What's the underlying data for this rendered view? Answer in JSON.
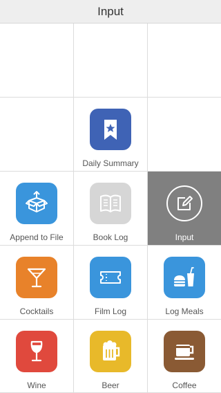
{
  "header": {
    "title": "Input"
  },
  "actions": [
    {
      "label": "Daily Summary",
      "icon": "bookmark-star-icon",
      "color": "#3f63b5"
    },
    {
      "label": "Append to File",
      "icon": "open-box-icon",
      "color": "#3a95dc"
    },
    {
      "label": "Book Log",
      "icon": "open-book-icon",
      "color": "#d6d6d6"
    },
    {
      "label": "Input",
      "icon": "pencil-square-icon",
      "color": "#808080",
      "selected": true
    },
    {
      "label": "Cocktails",
      "icon": "cocktail-glass-icon",
      "color": "#e8822a"
    },
    {
      "label": "Film Log",
      "icon": "ticket-icon",
      "color": "#3a95dc"
    },
    {
      "label": "Log Meals",
      "icon": "burger-drink-icon",
      "color": "#3a95dc"
    },
    {
      "label": "Wine",
      "icon": "wine-glass-icon",
      "color": "#e0493d"
    },
    {
      "label": "Beer",
      "icon": "beer-mug-icon",
      "color": "#e8b92a"
    },
    {
      "label": "Coffee",
      "icon": "coffee-cup-icon",
      "color": "#8a5a34"
    }
  ]
}
